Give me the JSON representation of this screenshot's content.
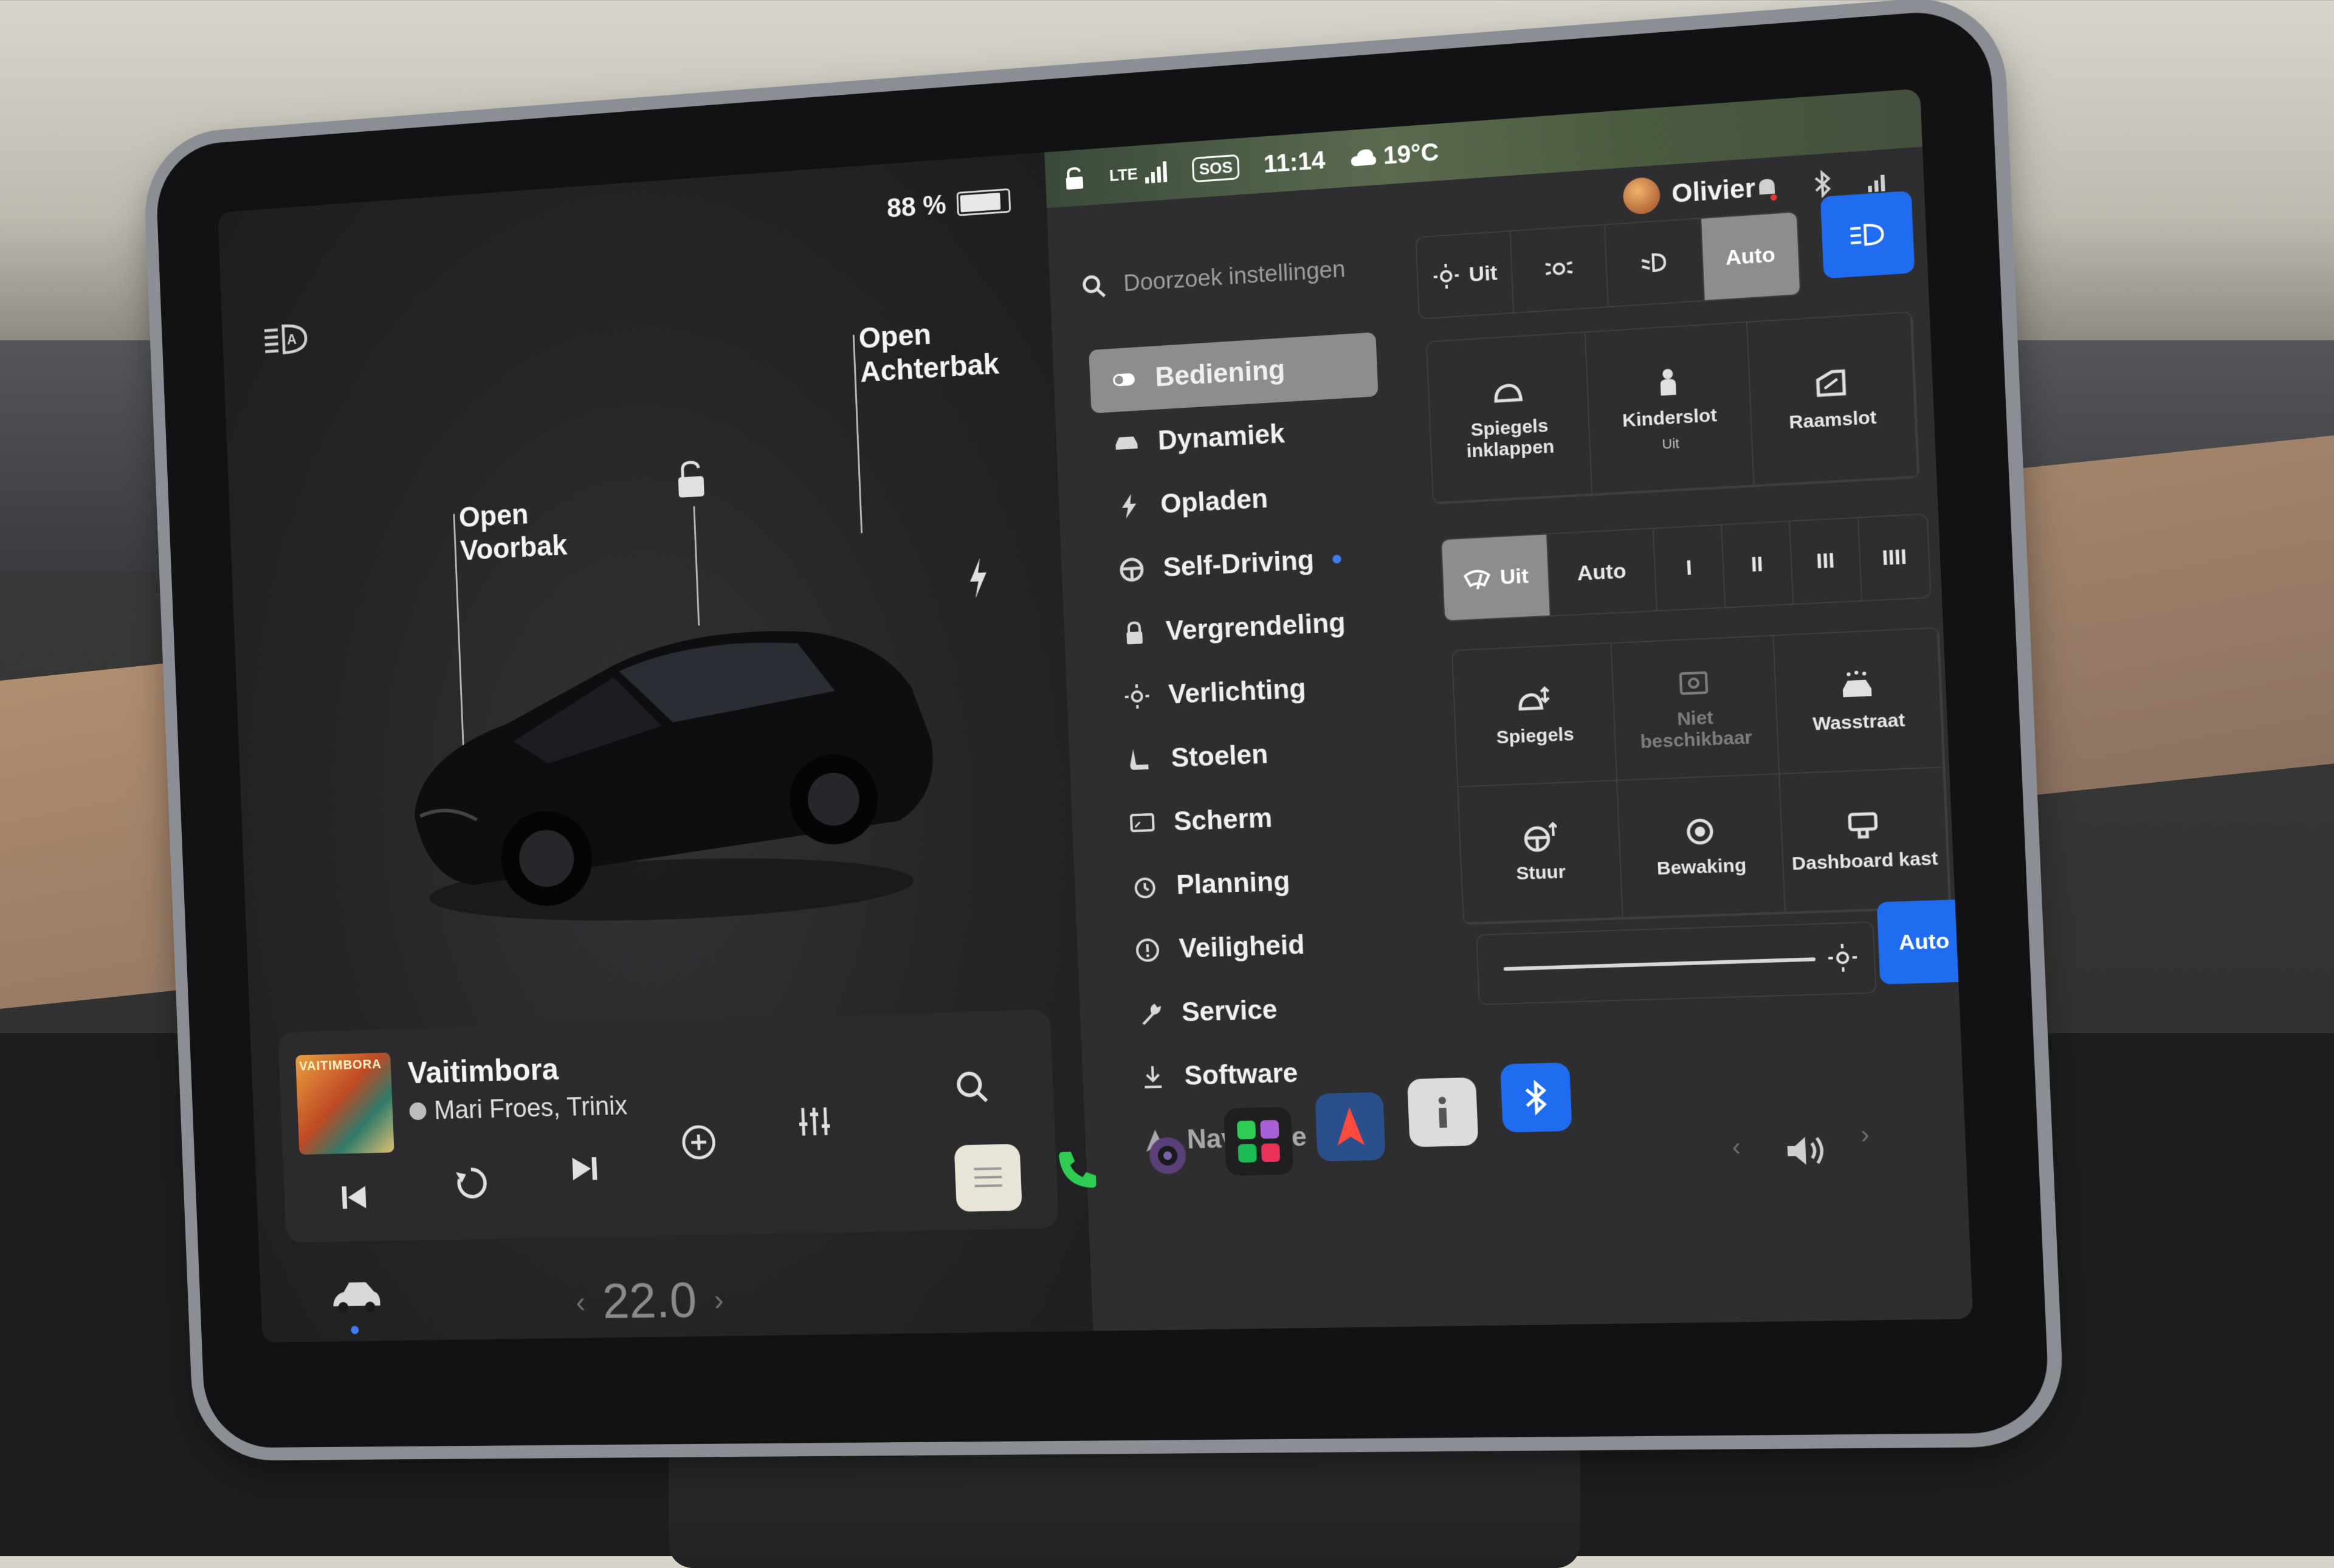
{
  "status_bar": {
    "battery_percent": "88 %",
    "battery_level": 0.88,
    "signal_label": "LTE",
    "sos_label": "SOS",
    "time": "11:14",
    "temperature": "19°C"
  },
  "car_view": {
    "front_trunk_label": "Open Voorbak",
    "front_trunk_line1": "Open",
    "front_trunk_line2": "Voorbak",
    "rear_trunk_line1": "Open",
    "rear_trunk_line2": "Achterbak",
    "headlight_indicator_icon": "auto-headlight-icon",
    "lock_icon": "unlocked-padlock-icon",
    "charge_port_icon": "lightning-bolt-icon"
  },
  "media": {
    "album_art_text": "VAITIMBORA",
    "title": "Vaitimbora",
    "artist": "Mari Froes, Trinix",
    "controls": [
      "previous-track-icon",
      "replay-icon",
      "next-track-icon",
      "add-icon",
      "equalizer-icon",
      "search-icon"
    ]
  },
  "climate": {
    "temperature": "22.0"
  },
  "header": {
    "user_name": "Olivier",
    "search_placeholder": "Doorzoek instellingen"
  },
  "nav": {
    "items": [
      {
        "label": "Bediening",
        "icon": "toggle-icon",
        "active": true
      },
      {
        "label": "Dynamiek",
        "icon": "car-icon"
      },
      {
        "label": "Opladen",
        "icon": "lightning-icon"
      },
      {
        "label": "Self-Driving",
        "icon": "steering-wheel-icon",
        "badge": true
      },
      {
        "label": "Vergrendeling",
        "icon": "lock-icon"
      },
      {
        "label": "Verlichting",
        "icon": "sun-icon"
      },
      {
        "label": "Stoelen",
        "icon": "seat-icon"
      },
      {
        "label": "Scherm",
        "icon": "display-icon"
      },
      {
        "label": "Planning",
        "icon": "alarm-clock-icon"
      },
      {
        "label": "Veiligheid",
        "icon": "alert-circle-icon"
      },
      {
        "label": "Service",
        "icon": "wrench-icon"
      },
      {
        "label": "Software",
        "icon": "download-icon"
      },
      {
        "label": "Navigatie",
        "icon": "navigation-arrow-icon"
      }
    ]
  },
  "controls": {
    "lights": {
      "off_label": "Uit",
      "auto_label": "Auto",
      "selected": "Auto"
    },
    "tiles_row1": [
      {
        "label": "Spiegels inklappen",
        "icon": "mirror-fold-icon"
      },
      {
        "label": "Kinderslot",
        "sub": "Uit",
        "icon": "child-lock-icon"
      },
      {
        "label": "Raamslot",
        "icon": "window-lock-icon"
      }
    ],
    "wipers": {
      "off_label": "Uit",
      "auto_label": "Auto",
      "speeds": [
        "I",
        "II",
        "III",
        "IIII"
      ],
      "selected": "Uit"
    },
    "tiles_row2": [
      {
        "label": "Spiegels",
        "icon": "mirror-adjust-icon"
      },
      {
        "label": "Niet beschikbaar",
        "icon": "camera-icon",
        "disabled": true
      },
      {
        "label": "Wasstraat",
        "icon": "car-wash-icon"
      },
      {
        "label": "Stuur",
        "icon": "steering-adjust-icon"
      },
      {
        "label": "Bewaking",
        "icon": "sentry-icon"
      },
      {
        "label": "Dashboard kast",
        "icon": "glovebox-icon"
      }
    ],
    "brightness_level": 0.9,
    "brightness_auto_label": "Auto"
  },
  "dock": {
    "apps": [
      "notes-icon",
      "phone-icon",
      "camera-icon",
      "apps-grid-icon",
      "navigation-icon",
      "info-icon",
      "bluetooth-icon"
    ]
  },
  "colors": {
    "accent": "#1f6cf0",
    "selected_grey": "#8d8d8f",
    "panel": "#2e2e30"
  }
}
